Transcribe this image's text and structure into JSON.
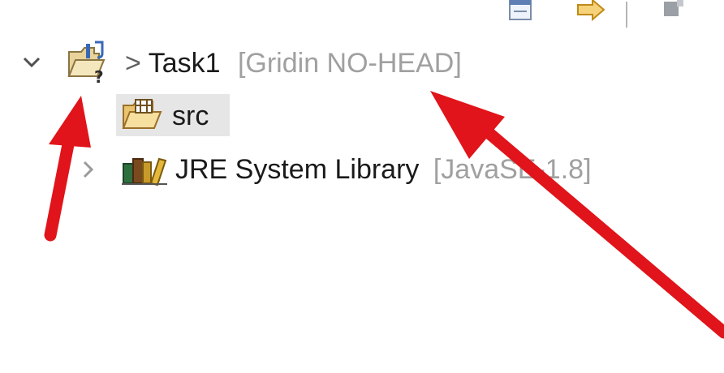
{
  "explorer": {
    "project": {
      "prefix": "> ",
      "name": "Task1",
      "decoration": "[Gridin NO-HEAD]",
      "expanded": true
    },
    "children": [
      {
        "label": "src",
        "decoration": "",
        "selected": true
      },
      {
        "label": "JRE System Library",
        "decoration": "[JavaSE-1.8]",
        "expanded": false
      }
    ]
  },
  "toolbar": {
    "icons": [
      "collapse-all-icon",
      "link-with-editor-icon",
      "view-menu-icon"
    ]
  },
  "annotations": {
    "arrow_color": "#e0141a"
  }
}
